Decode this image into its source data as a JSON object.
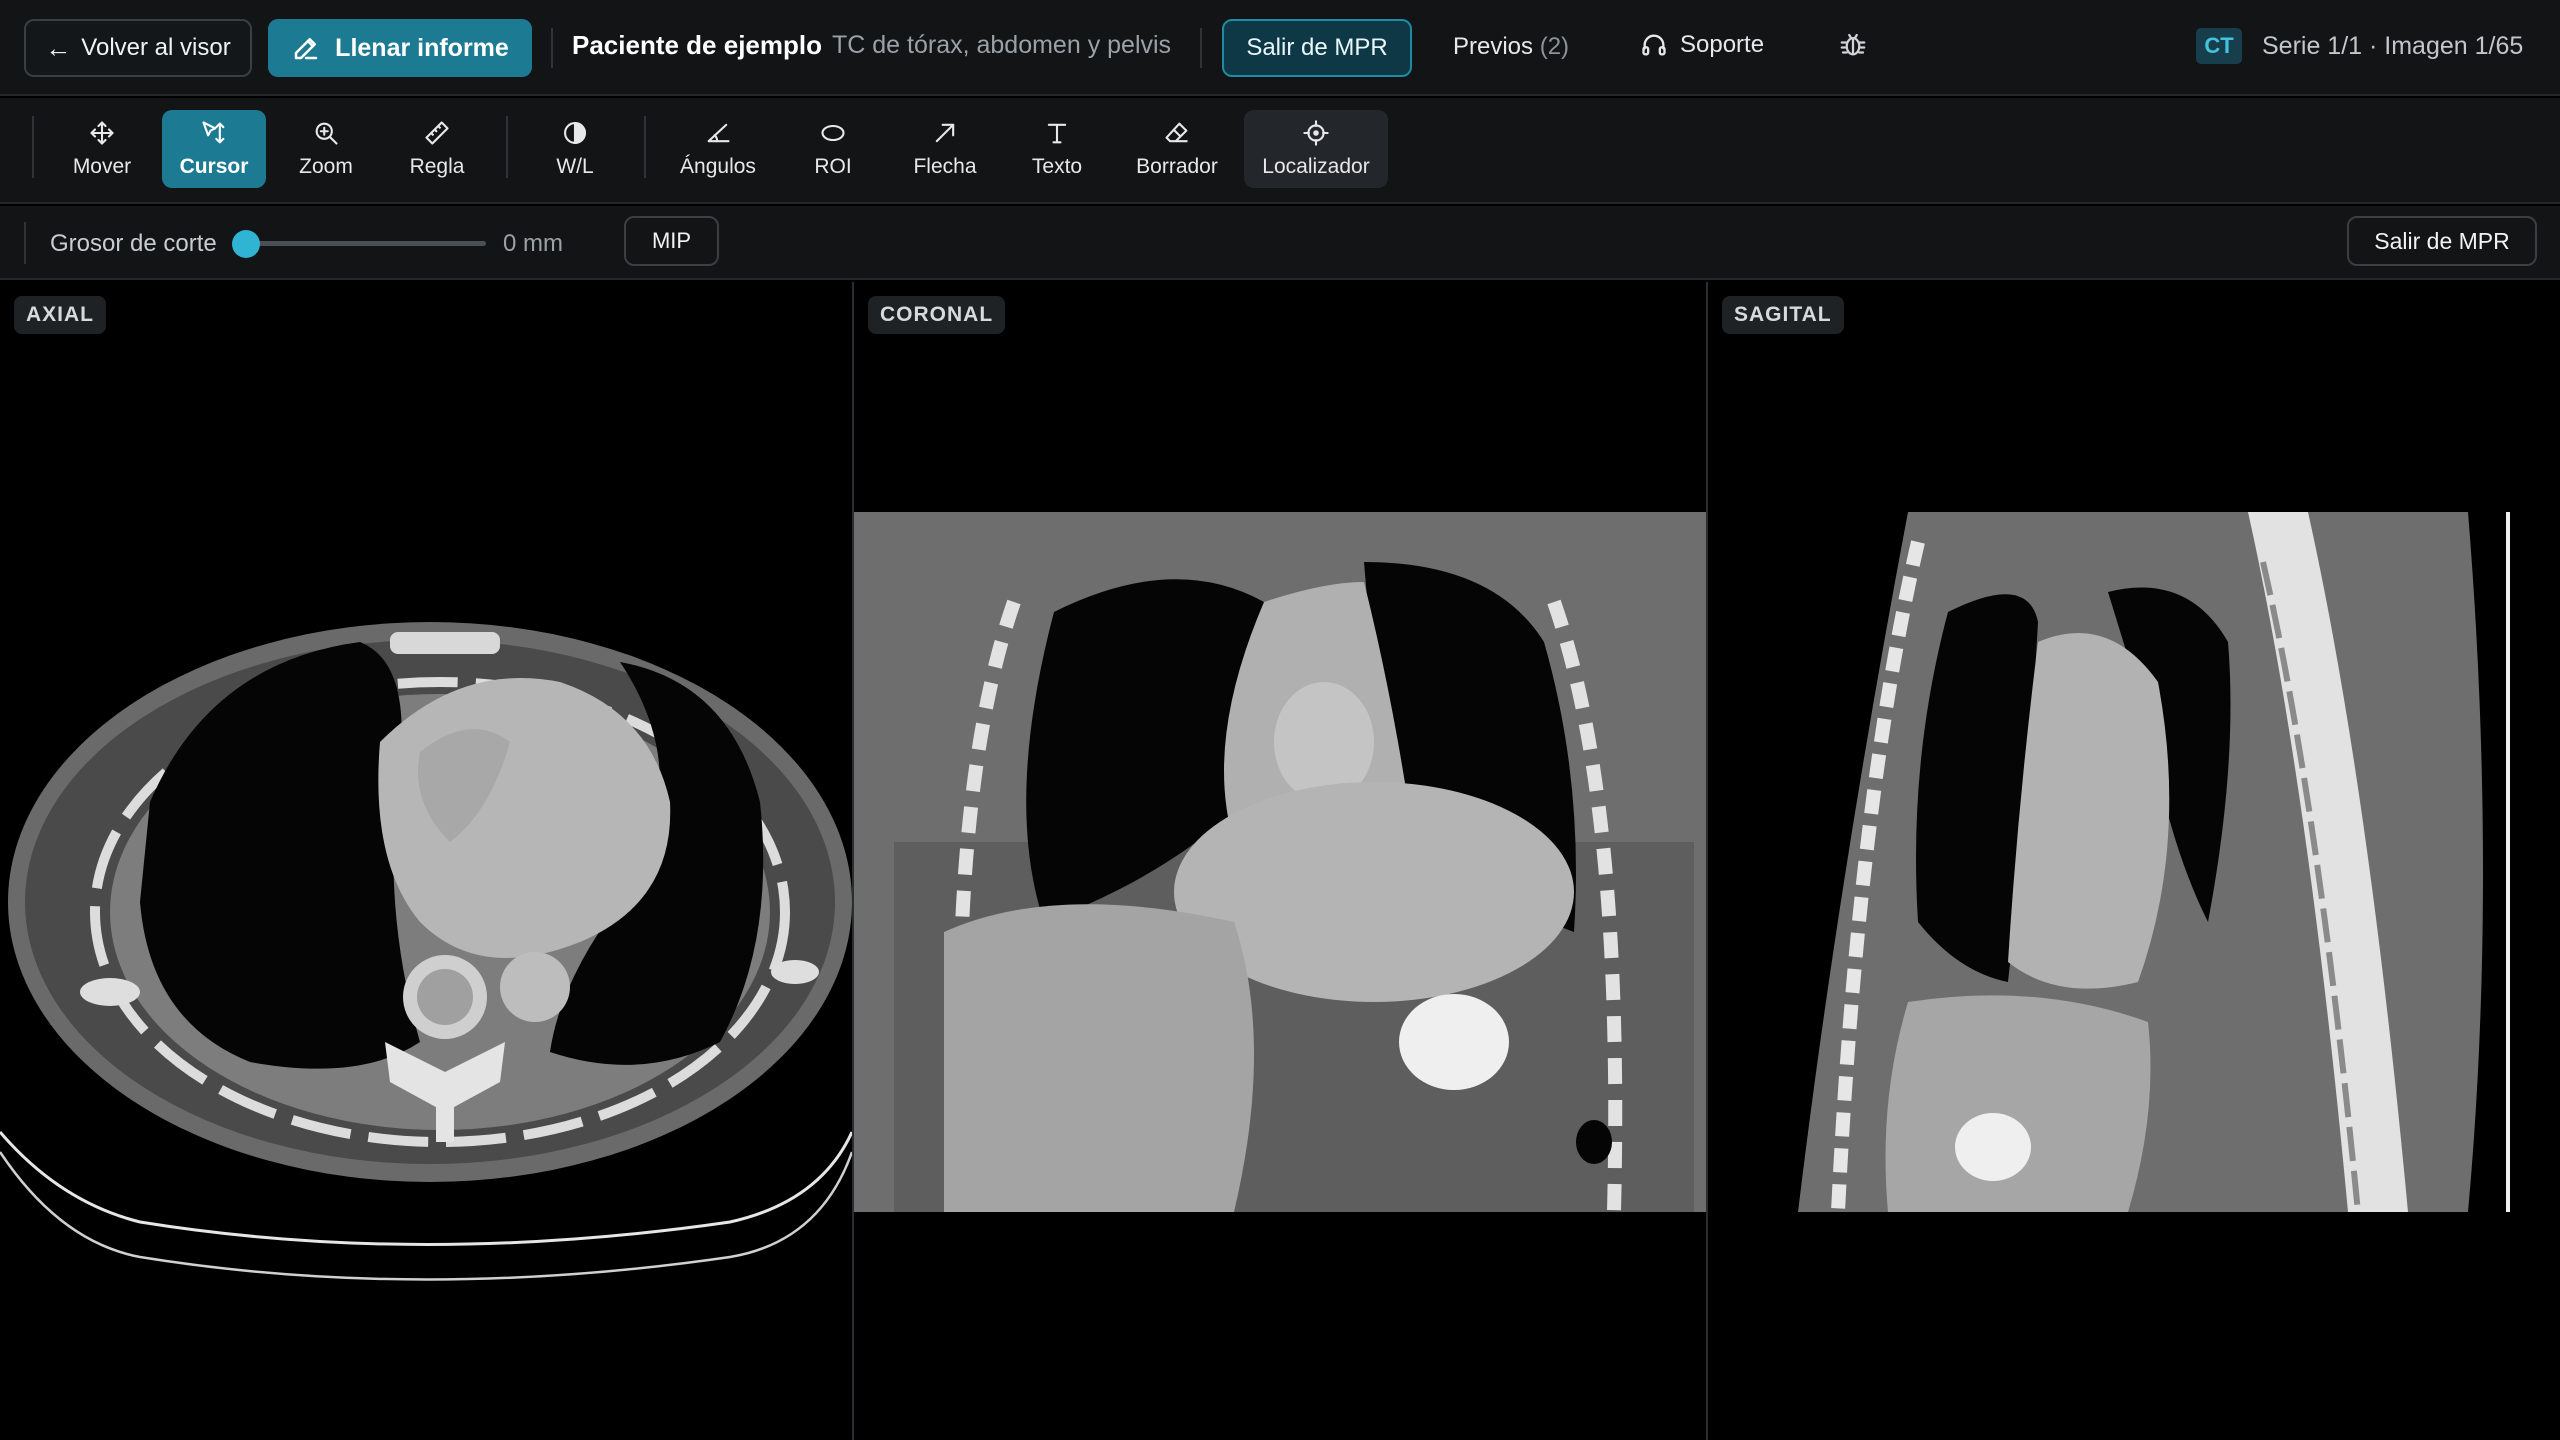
{
  "header": {
    "back_label": "Volver al visor",
    "report_label": "Llenar informe",
    "patient_name": "Paciente de ejemplo",
    "study_description": "TC de tórax, abdomen y pelvis",
    "exit_mpr_label": "Salir de MPR",
    "previous_label": "Previos",
    "previous_count": "(2)",
    "support_label": "Soporte",
    "modality": "CT",
    "series_info": "Serie 1/1 · Imagen 1/65"
  },
  "toolbar": {
    "tools": [
      {
        "label": "Mover",
        "icon": "move-icon"
      },
      {
        "label": "Cursor",
        "icon": "cursor-icon",
        "active": true
      },
      {
        "label": "Zoom",
        "icon": "zoom-icon"
      },
      {
        "label": "Regla",
        "icon": "ruler-icon"
      },
      {
        "label": "W/L",
        "icon": "contrast-icon"
      },
      {
        "label": "Ángulos",
        "icon": "angle-icon"
      },
      {
        "label": "ROI",
        "icon": "ellipse-icon"
      },
      {
        "label": "Flecha",
        "icon": "arrow-icon"
      },
      {
        "label": "Texto",
        "icon": "text-icon"
      },
      {
        "label": "Borrador",
        "icon": "eraser-icon"
      },
      {
        "label": "Localizador",
        "icon": "crosshair-icon"
      }
    ]
  },
  "slicebar": {
    "thickness_label": "Grosor de corte",
    "thickness_value": "0 mm",
    "thickness_fraction": 0,
    "mip_label": "MIP",
    "exit_mpr_label": "Salir de MPR"
  },
  "viewports": {
    "axial_label": "AXIAL",
    "coronal_label": "CORONAL",
    "sagittal_label": "SAGITAL"
  },
  "colors": {
    "accent": "#1d7a93",
    "accent_bright": "#2fb4d3",
    "background": "#121416"
  }
}
